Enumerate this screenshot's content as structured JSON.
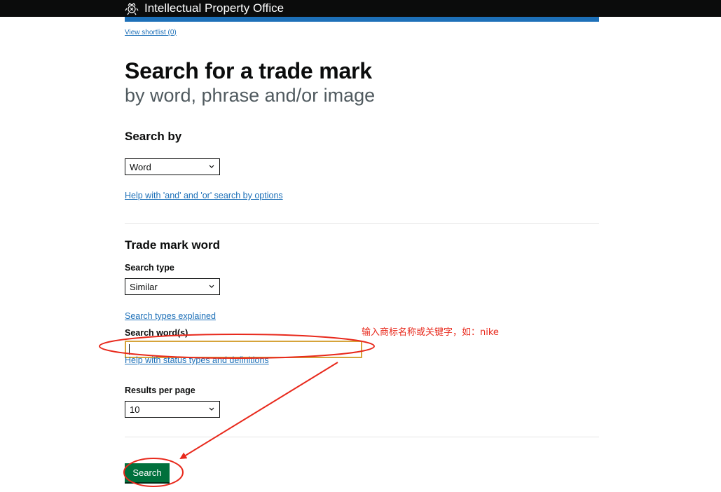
{
  "header": {
    "org_name": "Intellectual Property Office",
    "crest_icon": "royal-crest-icon"
  },
  "shortlist": {
    "label": "View shortlist (0)"
  },
  "page": {
    "title": "Search for a trade mark",
    "subtitle": "by word, phrase and/or image"
  },
  "search_by": {
    "heading": "Search by",
    "selected": "Word",
    "help_link": "Help with 'and' and 'or' search by options"
  },
  "trade_mark_word": {
    "heading": "Trade mark word",
    "search_type_label": "Search type",
    "search_type_selected": "Similar",
    "search_types_link": "Search types explained",
    "search_words_label": "Search word(s)",
    "search_words_value": "",
    "status_help_link": "Help with status types and definitions"
  },
  "results": {
    "label": "Results per page",
    "selected": "10"
  },
  "actions": {
    "search_label": "Search"
  },
  "annotation": {
    "text": "输入商标名称或关键字，如：nike",
    "color": "#e8291c"
  },
  "colors": {
    "link": "#1d70b8",
    "header_bg": "#0b0c0c",
    "accent_bar": "#1d70b8",
    "button": "#00703c"
  }
}
